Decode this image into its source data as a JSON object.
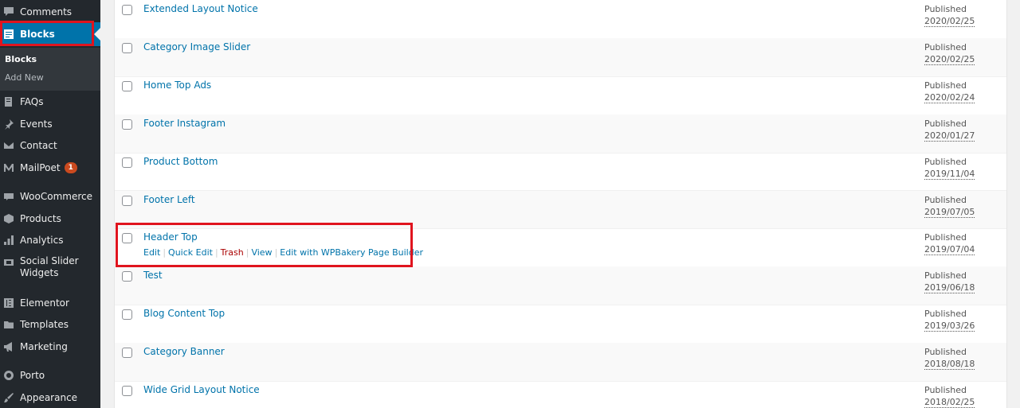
{
  "sidebar": {
    "items": [
      {
        "label": "Comments",
        "icon": "comments-icon"
      },
      {
        "label": "Blocks",
        "icon": "blocks-icon",
        "active": true
      },
      {
        "label": "FAQs",
        "icon": "faqs-icon"
      },
      {
        "label": "Events",
        "icon": "pin-icon"
      },
      {
        "label": "Contact",
        "icon": "mail-icon"
      },
      {
        "label": "MailPoet",
        "icon": "mailpoet-icon",
        "badge": "1"
      },
      {
        "label": "WooCommerce",
        "icon": "woocommerce-icon"
      },
      {
        "label": "Products",
        "icon": "products-icon"
      },
      {
        "label": "Analytics",
        "icon": "analytics-icon"
      },
      {
        "label": "Social Slider Widgets",
        "label_line1": "Social Slider",
        "label_line2": "Widgets",
        "icon": "social-slider-icon"
      },
      {
        "label": "Elementor",
        "icon": "elementor-icon"
      },
      {
        "label": "Templates",
        "icon": "folder-icon"
      },
      {
        "label": "Marketing",
        "icon": "megaphone-icon"
      },
      {
        "label": "Porto",
        "icon": "porto-icon"
      },
      {
        "label": "Appearance",
        "icon": "brush-icon"
      }
    ],
    "submenu": [
      {
        "label": "Blocks",
        "current": true
      },
      {
        "label": "Add New"
      }
    ]
  },
  "posts": [
    {
      "title": "Extended Layout Notice",
      "status": "Published",
      "date": "2020/02/25"
    },
    {
      "title": "Category Image Slider",
      "status": "Published",
      "date": "2020/02/25"
    },
    {
      "title": "Home Top Ads",
      "status": "Published",
      "date": "2020/02/24"
    },
    {
      "title": "Footer Instagram",
      "status": "Published",
      "date": "2020/01/27"
    },
    {
      "title": "Product Bottom",
      "status": "Published",
      "date": "2019/11/04"
    },
    {
      "title": "Footer Left",
      "status": "Published",
      "date": "2019/07/05"
    },
    {
      "title": "Header Top",
      "status": "Published",
      "date": "2019/07/04"
    },
    {
      "title": "Test",
      "status": "Published",
      "date": "2019/06/18"
    },
    {
      "title": "Blog Content Top",
      "status": "Published",
      "date": "2019/03/26"
    },
    {
      "title": "Category Banner",
      "status": "Published",
      "date": "2018/08/18"
    },
    {
      "title": "Wide Grid Layout Notice",
      "status": "Published",
      "date": "2018/02/25"
    }
  ],
  "row_actions": {
    "edit": "Edit",
    "quick_edit": "Quick Edit",
    "trash": "Trash",
    "view": "View",
    "edit_wpbakery": "Edit with WPBakery Page Builder"
  },
  "colors": {
    "sidebar_bg": "#23282d",
    "active_bg": "#0073aa",
    "link": "#0073aa",
    "highlight": "#e0141e",
    "trash": "#aa0000"
  }
}
